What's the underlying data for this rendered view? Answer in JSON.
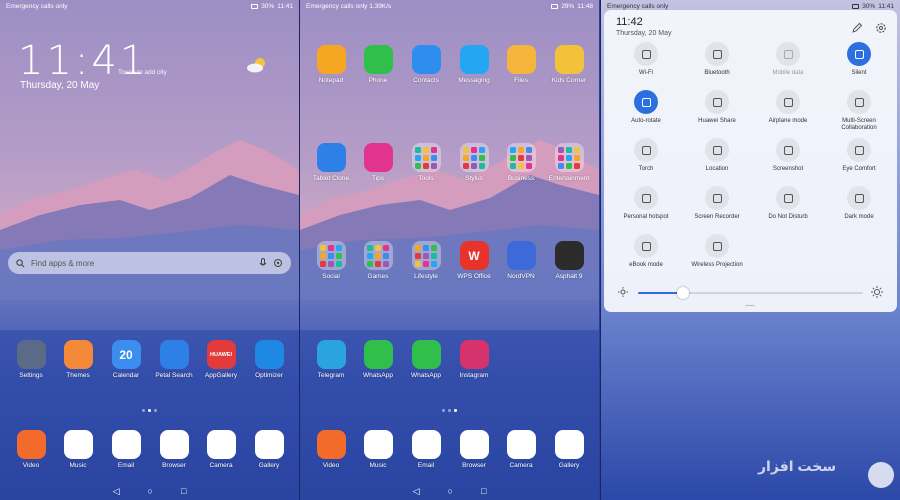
{
  "panel1": {
    "status": {
      "left": "Emergency calls only",
      "battery": "30%",
      "time": "11:41"
    },
    "clock": "11:41",
    "date": "Thursday, 20 May",
    "add_city": "Touch to add city",
    "search_placeholder": "Find apps & more",
    "apps": [
      {
        "label": "Settings",
        "icon": "settings-icon",
        "color": "#5b6a86"
      },
      {
        "label": "Themes",
        "icon": "brush-icon",
        "color": "#f28a3a"
      },
      {
        "label": "Calendar",
        "icon": "calendar-icon",
        "color": "#3b8ef0",
        "glyph": "20",
        "sub": "Thursday"
      },
      {
        "label": "Petal Search",
        "icon": "search-q-icon",
        "color": "#2e7fe6"
      },
      {
        "label": "AppGallery",
        "icon": "bag-icon",
        "color": "#e33b3b",
        "glyph": "HUAWEI"
      },
      {
        "label": "Optimizer",
        "icon": "shield-icon",
        "color": "#1e88e5"
      }
    ],
    "dock": [
      {
        "label": "Video",
        "icon": "play-icon",
        "color": "#f36b2b"
      },
      {
        "label": "Music",
        "icon": "music-icon",
        "color": "#ffffff"
      },
      {
        "label": "Email",
        "icon": "mail-icon",
        "color": "#ffffff"
      },
      {
        "label": "Browser",
        "icon": "globe-icon",
        "color": "#ffffff"
      },
      {
        "label": "Camera",
        "icon": "camera-icon",
        "color": "#ffffff"
      },
      {
        "label": "Gallery",
        "icon": "flower-icon",
        "color": "#ffffff"
      }
    ]
  },
  "panel2": {
    "status": {
      "left": "Emergency calls only",
      "speed": "1.39K/s",
      "battery": "29%",
      "time": "11:48"
    },
    "row1": [
      {
        "label": "Notepad",
        "icon": "notepad-icon",
        "color": "#f5a623"
      },
      {
        "label": "Phone",
        "icon": "phone-icon",
        "color": "#2fbf4a"
      },
      {
        "label": "Contacts",
        "icon": "contacts-icon",
        "color": "#2e8ef0"
      },
      {
        "label": "Messaging",
        "icon": "message-icon",
        "color": "#24a6f2"
      },
      {
        "label": "Files",
        "icon": "files-icon",
        "color": "#f5b43a"
      },
      {
        "label": "Kids Corner",
        "icon": "kids-icon",
        "color": "#f2c23b"
      }
    ],
    "row2": [
      {
        "label": "Tablet Clone",
        "icon": "clone-icon",
        "color": "#2e7fe6"
      },
      {
        "label": "Tips",
        "icon": "tips-icon",
        "color": "#e0348f"
      },
      {
        "label": "Tools",
        "icon": "folder-icon",
        "folder": true
      },
      {
        "label": "Stylus",
        "icon": "folder-icon",
        "folder": true
      },
      {
        "label": "Business",
        "icon": "folder-icon",
        "folder": true
      },
      {
        "label": "Entertainment",
        "icon": "folder-icon",
        "folder": true
      }
    ],
    "row3": [
      {
        "label": "Social",
        "icon": "folder-icon",
        "folder": true
      },
      {
        "label": "Games",
        "icon": "folder-icon",
        "folder": true
      },
      {
        "label": "Lifestyle",
        "icon": "folder-icon",
        "folder": true
      },
      {
        "label": "WPS Office",
        "icon": "wps-icon",
        "color": "#e8332a",
        "glyph": "W"
      },
      {
        "label": "NordVPN",
        "icon": "vpn-icon",
        "color": "#3d6ad8"
      },
      {
        "label": "Asphalt 9",
        "icon": "car-icon",
        "color": "#2b2b2b"
      }
    ],
    "row4": [
      {
        "label": "Telegram",
        "icon": "telegram-icon",
        "color": "#2aa3e0"
      },
      {
        "label": "WhatsApp",
        "icon": "whatsapp-icon",
        "color": "#2fbf4a"
      },
      {
        "label": "WhatsApp",
        "icon": "whatsapp-icon",
        "color": "#2fbf4a"
      },
      {
        "label": "Instagram",
        "icon": "instagram-icon",
        "color": "#d6336c"
      }
    ],
    "dock": [
      {
        "label": "Video",
        "icon": "play-icon",
        "color": "#f36b2b"
      },
      {
        "label": "Music",
        "icon": "music-icon",
        "color": "#ffffff"
      },
      {
        "label": "Email",
        "icon": "mail-icon",
        "color": "#ffffff"
      },
      {
        "label": "Browser",
        "icon": "globe-icon",
        "color": "#ffffff"
      },
      {
        "label": "Camera",
        "icon": "camera-icon",
        "color": "#ffffff"
      },
      {
        "label": "Gallery",
        "icon": "flower-icon",
        "color": "#ffffff"
      }
    ]
  },
  "panel3": {
    "status": {
      "left": "Emergency calls only",
      "battery": "30%",
      "time": "11:41"
    },
    "time": "11:42",
    "date": "Thursday, 20 May",
    "tiles": [
      {
        "label": "Wi-Fi",
        "icon": "wifi-icon",
        "on": false
      },
      {
        "label": "Bluetooth",
        "icon": "bluetooth-icon",
        "on": false
      },
      {
        "label": "Mobile data",
        "icon": "mobile-data-icon",
        "on": false,
        "dim": true
      },
      {
        "label": "Silent",
        "icon": "bell-off-icon",
        "on": true
      },
      {
        "label": "Auto-rotate",
        "icon": "rotate-icon",
        "on": true
      },
      {
        "label": "Huawei Share",
        "icon": "share-icon",
        "on": false
      },
      {
        "label": "Airplane mode",
        "icon": "airplane-icon",
        "on": false
      },
      {
        "label": "Multi-Screen Collaboration",
        "icon": "multiscreen-icon",
        "on": false
      },
      {
        "label": "Torch",
        "icon": "torch-icon",
        "on": false
      },
      {
        "label": "Location",
        "icon": "location-icon",
        "on": false
      },
      {
        "label": "Screenshot",
        "icon": "screenshot-icon",
        "on": false
      },
      {
        "label": "Eye Comfort",
        "icon": "eye-icon",
        "on": false
      },
      {
        "label": "Personal hotspot",
        "icon": "hotspot-icon",
        "on": false
      },
      {
        "label": "Screen Recorder",
        "icon": "recorder-icon",
        "on": false
      },
      {
        "label": "Do Not Disturb",
        "icon": "moon-icon",
        "on": false
      },
      {
        "label": "Dark mode",
        "icon": "dark-mode-icon",
        "on": false
      },
      {
        "label": "eBook mode",
        "icon": "book-icon",
        "on": false
      },
      {
        "label": "Wireless Projection",
        "icon": "projection-icon",
        "on": false
      }
    ],
    "brightness": 0.2
  },
  "watermark": "سخت افزار"
}
